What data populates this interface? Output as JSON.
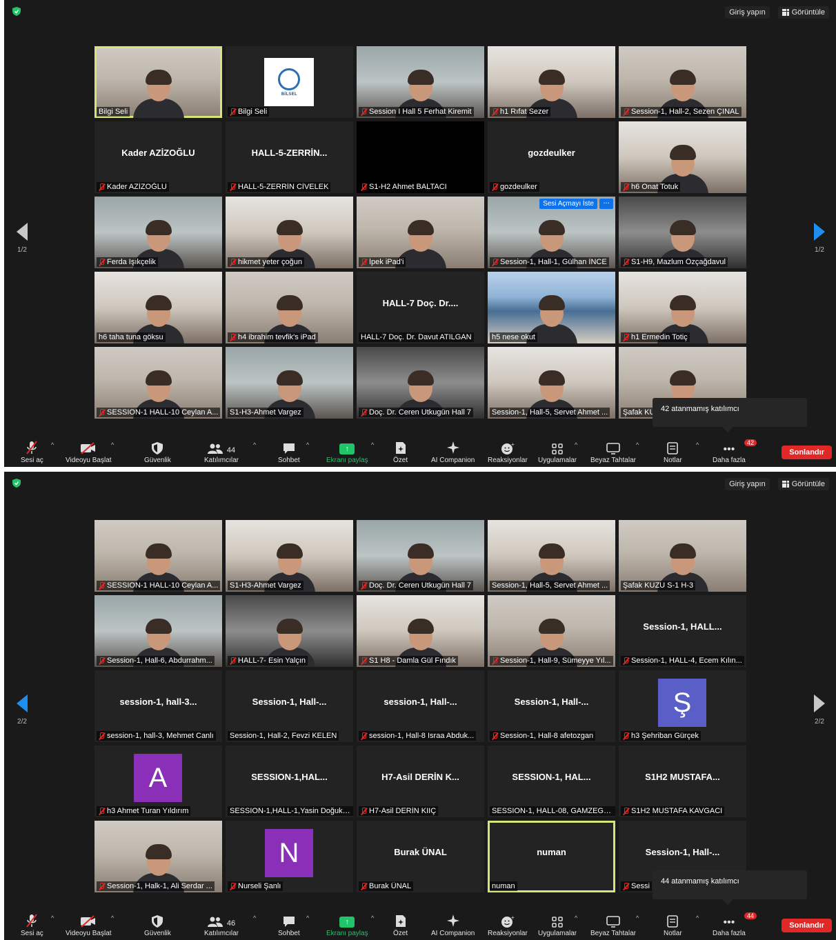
{
  "top": {
    "signin": "Giriş yapın",
    "view": "Görüntüle"
  },
  "toolbar": {
    "unmute": "Sesi aç",
    "start_video": "Videoyu Başlat",
    "security": "Güvenlik",
    "participants": "Katılımcılar",
    "chat": "Sohbet",
    "share": "Ekranı paylaş",
    "summary": "Özet",
    "ai": "AI Companion",
    "reactions": "Reaksiyonlar",
    "apps": "Uygulamalar",
    "whiteboards": "Beyaz Tahtalar",
    "notes": "Notlar",
    "more": "Daha fazla",
    "end": "Sonlandır"
  },
  "screen1": {
    "page": "1/2",
    "participant_count": "44",
    "more_badge": "42",
    "tooltip": "42 atanmamış katılımcı",
    "ask_unmute": "Sesi Açmayı İste",
    "more_dots": "···",
    "tiles": [
      {
        "name": "Bilgi Seli",
        "type": "video",
        "muted": false
      },
      {
        "name": "Bilgi Seli",
        "type": "logo",
        "muted": true,
        "logo_text": "BİLSEL"
      },
      {
        "name": "Session I Hall 5 Ferhat Kiremit",
        "type": "video",
        "muted": true
      },
      {
        "name": "h1 Rıfat Sezer",
        "type": "video",
        "muted": true
      },
      {
        "name": "Session-1, Hall-2, Sezen ÇINAL",
        "type": "video",
        "muted": true
      },
      {
        "name": "Kader AZİZOĞLU",
        "type": "name",
        "big": "Kader AZİZOĞLU",
        "muted": true
      },
      {
        "name": "HALL-5-ZERRİN CİVELEK",
        "type": "name",
        "big": "HALL-5-ZERRİN...",
        "muted": true
      },
      {
        "name": "S1-H2 Ahmet BALTACI",
        "type": "black",
        "muted": true
      },
      {
        "name": "gozdeulker",
        "type": "name",
        "big": "gozdeulker",
        "muted": true
      },
      {
        "name": "h6 Onat Totuk",
        "type": "video",
        "muted": true
      },
      {
        "name": "Ferda Işıkçelik",
        "type": "video",
        "muted": true
      },
      {
        "name": "hikmet yeter çoğun",
        "type": "video",
        "muted": true
      },
      {
        "name": "İpek iPad'i",
        "type": "video",
        "muted": true
      },
      {
        "name": "Session-1, Hall-1, Gülhan İNCE",
        "type": "video",
        "muted": true
      },
      {
        "name": "S1-H9, Mazlum Özçağdavul",
        "type": "video",
        "muted": true
      },
      {
        "name": "h6 taha tuna göksu",
        "type": "video",
        "muted": false
      },
      {
        "name": "h4 ibrahim tevfik's iPad",
        "type": "video",
        "muted": true
      },
      {
        "name": "HALL-7 Doç. Dr. Davut ATILGAN",
        "type": "name",
        "big": "HALL-7 Doç. Dr....",
        "muted": false
      },
      {
        "name": "h5 nese okut",
        "type": "video",
        "muted": false
      },
      {
        "name": "h1 Ermedin Totiç",
        "type": "video",
        "muted": true
      },
      {
        "name": "SESSION-1 HALL-10 Ceylan A...",
        "type": "video",
        "muted": true
      },
      {
        "name": "S1-H3-Ahmet Vargez",
        "type": "video",
        "muted": false
      },
      {
        "name": "Doç. Dr. Ceren Utkugün Hall 7",
        "type": "video",
        "muted": true
      },
      {
        "name": "Session-1, Hall-5, Servet Ahmet ...",
        "type": "video",
        "muted": false
      },
      {
        "name": "Şafak KU",
        "type": "video",
        "muted": false
      }
    ]
  },
  "screen2": {
    "page": "2/2",
    "participant_count": "46",
    "more_badge": "44",
    "tooltip": "44 atanmamış katılımcı",
    "tiles": [
      {
        "name": "SESSION-1 HALL-10 Ceylan A...",
        "type": "video",
        "muted": true
      },
      {
        "name": "S1-H3-Ahmet Vargez",
        "type": "video",
        "muted": false
      },
      {
        "name": "Doç. Dr. Ceren Utkugün Hall 7",
        "type": "video",
        "muted": true
      },
      {
        "name": "Session-1, Hall-5, Servet Ahmet ...",
        "type": "video",
        "muted": false
      },
      {
        "name": "Şafak KUZU S-1 H-3",
        "type": "video",
        "muted": false
      },
      {
        "name": "Session-1, Hall-6, Abdurrahm...",
        "type": "video",
        "muted": true
      },
      {
        "name": "HALL-7- Esin Yalçın",
        "type": "video",
        "muted": true
      },
      {
        "name": "S1 H8 - Damla Gül Fındık",
        "type": "video",
        "muted": true
      },
      {
        "name": "Session-1, Hall-9, Sümeyye Yıl...",
        "type": "video",
        "muted": true
      },
      {
        "name": "Session-1, HALL-4, Ecem Kılın...",
        "type": "name",
        "big": "Session-1, HALL...",
        "muted": true
      },
      {
        "name": "session-1, hall-3, Mehmet Canlı",
        "type": "name",
        "big": "session-1, hall-3...",
        "muted": true
      },
      {
        "name": "Session-1, Hall-2, Fevzi KELEN",
        "type": "name",
        "big": "Session-1, Hall-...",
        "muted": false
      },
      {
        "name": "session-1, Hall-8 Israa Abduk...",
        "type": "name",
        "big": "session-1, Hall-...",
        "muted": true
      },
      {
        "name": "Session-1, Hall-8 afetozgan",
        "type": "name",
        "big": "Session-1, Hall-...",
        "muted": true
      },
      {
        "name": "h3 Şehriban Gürçek",
        "type": "avatar",
        "letter": "Ş",
        "color": "#5a5fc8",
        "muted": true
      },
      {
        "name": "h3 Ahmet Turan Yıldırım",
        "type": "avatar",
        "letter": "A",
        "color": "#8a2fb8",
        "muted": true
      },
      {
        "name": "SESSION-1,HALL-1,Yasin Doğuka...",
        "type": "name",
        "big": "SESSION-1,HAL...",
        "muted": false
      },
      {
        "name": "H7-Asil DERİN KIIÇ",
        "type": "name",
        "big": "H7-Asil DERİN K...",
        "muted": true
      },
      {
        "name": "SESSION-1, HALL-08, GAMZEGÜL...",
        "type": "name",
        "big": "SESSION-1, HAL...",
        "muted": false
      },
      {
        "name": "S1H2 MUSTAFA KAVGACI",
        "type": "name",
        "big": "S1H2 MUSTAFA...",
        "muted": true
      },
      {
        "name": "Session-1, Halk-1, Ali Serdar ...",
        "type": "video",
        "muted": true
      },
      {
        "name": "Nurseli Şanlı",
        "type": "avatar",
        "letter": "N",
        "color": "#8a2fb8",
        "muted": true
      },
      {
        "name": "Burak ÜNAL",
        "type": "name",
        "big": "Burak ÜNAL",
        "muted": true
      },
      {
        "name": "numan",
        "type": "name",
        "big": "numan",
        "muted": false,
        "active": true
      },
      {
        "name": "Sessi",
        "type": "name",
        "big": "Session-1, Hall-...",
        "muted": true
      }
    ]
  }
}
